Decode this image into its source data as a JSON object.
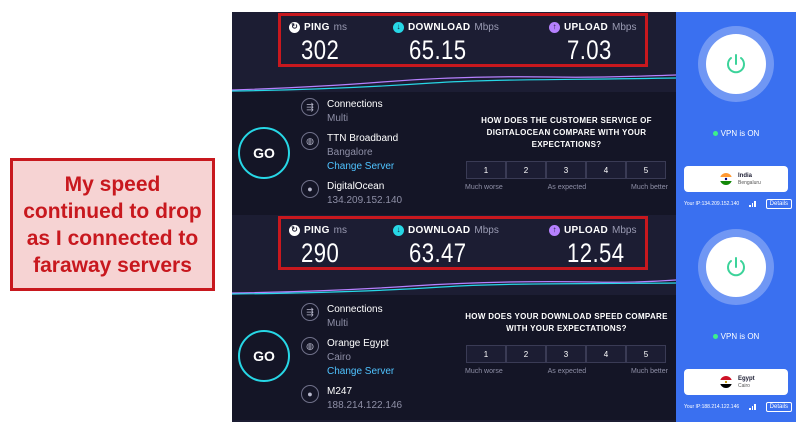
{
  "callout": {
    "lines": [
      "My speed",
      "continued to drop",
      "as I connected to",
      "faraway servers"
    ]
  },
  "colors": {
    "accent_red": "#c8181e",
    "callout_bg": "#f6d3d3",
    "panel_bg": "#1c1d33",
    "vpn_blue": "#3a70f0",
    "ping_icon": "#ffffff",
    "download_icon": "#27d7e6",
    "upload_icon": "#b681ff"
  },
  "tests": [
    {
      "metrics": {
        "ping": {
          "name": "PING",
          "unit": "ms",
          "value": "302",
          "icon": "ping-icon"
        },
        "download": {
          "name": "DOWNLOAD",
          "unit": "Mbps",
          "value": "65.15",
          "icon": "download-arrow-icon"
        },
        "upload": {
          "name": "UPLOAD",
          "unit": "Mbps",
          "value": "7.03",
          "icon": "upload-arrow-icon"
        }
      },
      "go_label": "GO",
      "connections": {
        "title": "Connections",
        "value": "Multi"
      },
      "isp": {
        "name": "TTN Broadband",
        "city": "Bangalore",
        "change_label": "Change Server"
      },
      "host": {
        "name": "DigitalOcean",
        "ip": "134.209.152.140"
      },
      "survey": {
        "question": "HOW DOES THE CUSTOMER SERVICE OF DIGITALOCEAN COMPARE WITH YOUR EXPECTATIONS?",
        "options": [
          "1",
          "2",
          "3",
          "4",
          "5"
        ],
        "labels": [
          "Much worse",
          "As expected",
          "Much better"
        ]
      },
      "vpn": {
        "status": "VPN is ON",
        "country": "India",
        "city": "Bengaluru",
        "ip_text": "Your IP:134.209.152.140",
        "details_label": "Details"
      }
    },
    {
      "metrics": {
        "ping": {
          "name": "PING",
          "unit": "ms",
          "value": "290",
          "icon": "ping-icon"
        },
        "download": {
          "name": "DOWNLOAD",
          "unit": "Mbps",
          "value": "63.47",
          "icon": "download-arrow-icon"
        },
        "upload": {
          "name": "UPLOAD",
          "unit": "Mbps",
          "value": "12.54",
          "icon": "upload-arrow-icon"
        }
      },
      "go_label": "GO",
      "connections": {
        "title": "Connections",
        "value": "Multi"
      },
      "isp": {
        "name": "Orange Egypt",
        "city": "Cairo",
        "change_label": "Change Server"
      },
      "host": {
        "name": "M247",
        "ip": "188.214.122.146"
      },
      "survey": {
        "question": "HOW DOES YOUR DOWNLOAD SPEED COMPARE WITH YOUR EXPECTATIONS?",
        "options": [
          "1",
          "2",
          "3",
          "4",
          "5"
        ],
        "labels": [
          "Much worse",
          "As expected",
          "Much better"
        ]
      },
      "vpn": {
        "status": "VPN is ON",
        "country": "Egypt",
        "city": "Cairo",
        "ip_text": "Your IP:188.214.122.146",
        "details_label": "Details"
      }
    }
  ]
}
